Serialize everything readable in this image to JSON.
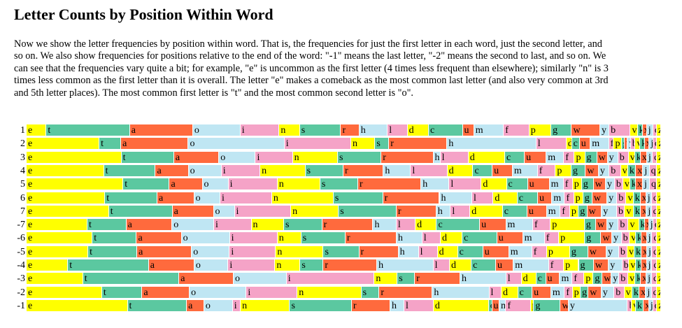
{
  "title": "Letter Counts by Position Within Word",
  "intro": "Now we show the letter frequencies by position within word. That is, the frequencies for just the first letter in each word, just the second letter, and so on. We also show frequencies for positions relative to the end of the word: \"-1\" means the last letter, \"-2\" means the second to last, and so on. We can see that the frequencies vary quite a bit; for example, \"e\" is uncommon as the first letter (4 times less frequent than elsewhere); similarly \"n\" is 3 times less common as the first letter than it is overall. The letter \"e\" makes a comeback as the most common last letter (and also very common at 3rd and 5th letter places). The most common first letter is \"t\" and the most common second letter is \"o\".",
  "colors": {
    "e": "#ffff00",
    "t": "#5bc8a0",
    "a": "#ff6a3d",
    "o": "#bfe6f3",
    "i": "#f5a3c7",
    "n": "#ffff00",
    "s": "#5bc8a0",
    "r": "#ff6a3d",
    "h": "#bfe6f3",
    "l": "#f5a3c7",
    "d": "#ffff00",
    "c": "#5bc8a0",
    "u": "#ff6a3d",
    "m": "#bfe6f3",
    "f": "#f5a3c7",
    "p": "#ffff00",
    "g": "#5bc8a0",
    "w": "#ff6a3d",
    "y": "#bfe6f3",
    "b": "#f5a3c7",
    "v": "#ffff00",
    "k": "#5bc8a0",
    "x": "#ff6a3d",
    "j": "#bfe6f3",
    "q": "#f5a3c7",
    "z": "#ffff00"
  },
  "chart_data": {
    "type": "bar",
    "stacked": true,
    "normalized": true,
    "positions": [
      "1",
      "2",
      "3",
      "4",
      "5",
      "6",
      "7",
      "-7",
      "-6",
      "-5",
      "-4",
      "-3",
      "-2",
      "-1"
    ],
    "letters": [
      "e",
      "t",
      "a",
      "o",
      "i",
      "n",
      "s",
      "r",
      "h",
      "l",
      "d",
      "c",
      "u",
      "m",
      "f",
      "p",
      "g",
      "w",
      "y",
      "b",
      "v",
      "k",
      "x",
      "j",
      "q",
      "z"
    ],
    "rows": [
      {
        "position": "1",
        "values": {
          "e": 2.8,
          "t": 11.8,
          "a": 8.9,
          "o": 6.7,
          "i": 5.5,
          "n": 2.9,
          "s": 5.8,
          "r": 2.6,
          "h": 4.0,
          "l": 2.8,
          "d": 3.0,
          "c": 4.8,
          "u": 1.6,
          "m": 4.2,
          "f": 3.6,
          "p": 3.1,
          "g": 2.9,
          "w": 4.0,
          "y": 1.3,
          "b": 3.0,
          "v": 1.0,
          "k": 0.7,
          "x": 0.6,
          "j": 0.9,
          "q": 0.5,
          "z": 0.6
        }
      },
      {
        "position": "2",
        "values": {
          "e": 9.4,
          "t": 2.8,
          "a": 8.7,
          "o": 12.4,
          "i": 8.6,
          "n": 3.1,
          "s": 1.8,
          "r": 7.5,
          "h": 11.5,
          "l": 3.9,
          "d": 0.7,
          "c": 1.0,
          "u": 1.4,
          "m": 2.4,
          "f": 0.6,
          "p": 1.0,
          "g": 0.4,
          "w": 0.4,
          "y": 0.4,
          "b": 0.6,
          "v": 0.6,
          "k": 0.6,
          "x": 0.6,
          "j": 0.5,
          "q": 0.5,
          "z": 0.5
        }
      },
      {
        "position": "3",
        "values": {
          "e": 13.5,
          "t": 7.5,
          "a": 6.4,
          "o": 5.2,
          "i": 5.3,
          "n": 6.4,
          "s": 6.2,
          "r": 7.4,
          "h": 1.0,
          "l": 4.0,
          "d": 5.2,
          "c": 2.8,
          "u": 3.1,
          "m": 2.5,
          "f": 1.5,
          "p": 1.5,
          "g": 1.7,
          "w": 1.5,
          "y": 1.5,
          "b": 1.5,
          "v": 0.9,
          "k": 0.8,
          "x": 0.9,
          "j": 0.8,
          "q": 0.6,
          "z": 0.6
        }
      },
      {
        "position": "4",
        "values": {
          "e": 10.8,
          "t": 7.2,
          "a": 4.6,
          "o": 4.6,
          "i": 5.4,
          "n": 6.3,
          "s": 5.3,
          "r": 5.6,
          "h": 3.8,
          "l": 5.1,
          "d": 3.6,
          "c": 2.7,
          "u": 2.8,
          "m": 3.5,
          "f": 2.5,
          "p": 2.2,
          "g": 2.0,
          "w": 1.8,
          "y": 1.5,
          "b": 1.6,
          "v": 1.0,
          "k": 1.1,
          "x": 1.0,
          "j": 0.9,
          "q": 1.0,
          "z": 0.6
        }
      },
      {
        "position": "5",
        "values": {
          "e": 13.8,
          "t": 6.6,
          "a": 4.7,
          "o": 3.7,
          "i": 7.0,
          "n": 6.1,
          "s": 5.4,
          "r": 9.0,
          "h": 4.0,
          "l": 4.6,
          "d": 3.6,
          "c": 3.0,
          "u": 3.1,
          "m": 2.0,
          "f": 1.3,
          "p": 1.3,
          "g": 1.7,
          "w": 1.7,
          "y": 1.3,
          "b": 1.2,
          "v": 1.0,
          "k": 0.8,
          "x": 1.0,
          "j": 1.0,
          "q": 1.0,
          "z": 0.6
        }
      },
      {
        "position": "6",
        "values": {
          "e": 11.1,
          "t": 7.4,
          "a": 5.2,
          "o": 3.7,
          "i": 7.3,
          "n": 8.7,
          "s": 7.0,
          "r": 8.0,
          "h": 4.6,
          "l": 3.0,
          "d": 3.4,
          "c": 2.9,
          "u": 2.0,
          "m": 1.8,
          "f": 1.3,
          "p": 1.3,
          "g": 1.3,
          "w": 2.1,
          "y": 1.4,
          "b": 1.3,
          "v": 1.0,
          "k": 1.0,
          "x": 0.8,
          "j": 0.8,
          "q": 0.7,
          "z": 0.6
        }
      },
      {
        "position": "7",
        "values": {
          "e": 11.4,
          "t": 8.8,
          "a": 5.7,
          "o": 2.9,
          "i": 7.8,
          "n": 6.6,
          "s": 8.0,
          "r": 5.5,
          "h": 2.0,
          "l": 2.7,
          "d": 4.5,
          "c": 3.4,
          "u": 2.7,
          "m": 1.9,
          "f": 1.3,
          "p": 1.2,
          "g": 1.2,
          "w": 2.0,
          "y": 2.1,
          "b": 1.1,
          "v": 1.2,
          "k": 1.0,
          "x": 0.8,
          "j": 0.7,
          "q": 0.7,
          "z": 0.6
        }
      },
      {
        "position": "-7",
        "values": {
          "e": 8.6,
          "t": 5.5,
          "a": 6.5,
          "o": 5.9,
          "i": 5.3,
          "n": 4.6,
          "s": 5.4,
          "r": 7.2,
          "h": 3.3,
          "l": 2.7,
          "d": 3.0,
          "c": 6.1,
          "u": 3.7,
          "m": 3.8,
          "f": 2.5,
          "p": 4.8,
          "g": 1.6,
          "w": 1.6,
          "y": 1.6,
          "b": 1.4,
          "v": 1.5,
          "k": 0.8,
          "x": 0.6,
          "j": 0.6,
          "q": 0.5,
          "z": 0.6
        }
      },
      {
        "position": "-6",
        "values": {
          "e": 9.7,
          "t": 6.5,
          "a": 6.6,
          "o": 7.1,
          "i": 7.0,
          "n": 3.5,
          "s": 6.5,
          "r": 7.5,
          "h": 3.8,
          "l": 2.7,
          "d": 3.2,
          "c": 5.1,
          "u": 3.8,
          "m": 3.2,
          "f": 2.1,
          "p": 3.8,
          "g": 2.4,
          "w": 1.6,
          "y": 1.4,
          "b": 1.2,
          "v": 0.9,
          "k": 0.8,
          "x": 0.8,
          "j": 0.8,
          "q": 0.7,
          "z": 0.6
        }
      },
      {
        "position": "-5",
        "values": {
          "e": 8.8,
          "t": 7.0,
          "a": 7.8,
          "o": 5.4,
          "i": 6.6,
          "n": 6.8,
          "s": 5.1,
          "r": 5.6,
          "h": 2.9,
          "l": 2.7,
          "d": 2.9,
          "c": 3.6,
          "u": 3.7,
          "m": 3.3,
          "f": 2.1,
          "p": 3.3,
          "g": 2.6,
          "w": 2.6,
          "y": 1.8,
          "b": 1.2,
          "v": 1.0,
          "k": 1.0,
          "x": 0.8,
          "j": 0.7,
          "q": 0.7,
          "z": 0.6
        }
      },
      {
        "position": "-4",
        "values": {
          "e": 6.1,
          "t": 11.9,
          "a": 6.7,
          "o": 5.0,
          "i": 6.9,
          "n": 3.7,
          "s": 3.4,
          "r": 7.9,
          "h": 8.3,
          "l": 2.4,
          "d": 3.2,
          "c": 3.6,
          "u": 2.6,
          "m": 5.2,
          "f": 2.2,
          "p": 2.2,
          "g": 2.2,
          "w": 2.2,
          "y": 2.0,
          "b": 1.0,
          "v": 1.0,
          "k": 0.8,
          "x": 0.8,
          "j": 0.8,
          "q": 0.7,
          "z": 0.6
        }
      },
      {
        "position": "-3",
        "values": {
          "e": 8.1,
          "t": 13.8,
          "a": 7.8,
          "o": 7.6,
          "i": 12.6,
          "n": 3.3,
          "s": 2.5,
          "r": 6.5,
          "h": 6.6,
          "l": 2.2,
          "d": 2.1,
          "c": 1.4,
          "u": 2.0,
          "m": 1.8,
          "f": 1.7,
          "p": 1.3,
          "g": 1.3,
          "w": 1.3,
          "y": 1.1,
          "b": 1.3,
          "v": 1.0,
          "k": 0.8,
          "x": 0.8,
          "j": 0.8,
          "q": 0.7,
          "z": 0.6
        }
      },
      {
        "position": "-2",
        "values": {
          "e": 10.5,
          "t": 5.6,
          "a": 6.6,
          "o": 7.9,
          "i": 7.1,
          "n": 8.9,
          "s": 2.5,
          "r": 7.4,
          "h": 7.9,
          "l": 1.7,
          "d": 2.3,
          "c": 2.0,
          "u": 2.6,
          "m": 1.9,
          "f": 1.1,
          "p": 1.1,
          "g": 1.1,
          "w": 1.8,
          "y": 1.8,
          "b": 1.4,
          "v": 1.1,
          "k": 1.0,
          "x": 0.9,
          "j": 0.8,
          "q": 0.7,
          "z": 0.6
        }
      },
      {
        "position": "-1",
        "values": {
          "e": 15.2,
          "t": 8.9,
          "a": 2.6,
          "o": 4.3,
          "i": 1.2,
          "n": 7.4,
          "s": 9.3,
          "r": 5.8,
          "h": 2.1,
          "l": 4.4,
          "d": 8.3,
          "c": 0.5,
          "u": 1.1,
          "m": 1.0,
          "f": 3.7,
          "p": 0.5,
          "g": 4.0,
          "w": 1.2,
          "y": 8.9,
          "b": 0.6,
          "v": 0.6,
          "k": 1.2,
          "x": 0.8,
          "j": 0.6,
          "q": 0.6,
          "z": 0.6
        }
      }
    ]
  }
}
